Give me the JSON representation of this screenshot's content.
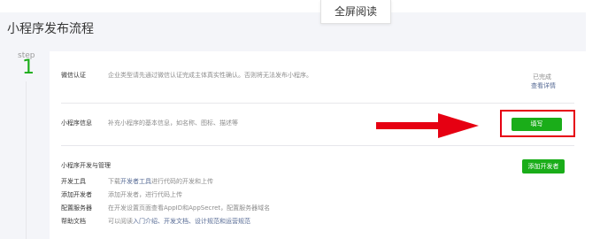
{
  "page": {
    "title": "小程序发布流程",
    "fullscreen_label": "全屏阅读"
  },
  "step": {
    "label": "step",
    "number": "1"
  },
  "rows": {
    "verify": {
      "label": "微信认证",
      "desc": "企业类型请先通过微信认证完成主体真实性确认。否则将无法发布小程序。",
      "status": "已完成",
      "link": "查看详情"
    },
    "info": {
      "label": "小程序信息",
      "desc": "补充小程序的基本信息，如名称、图标、描述等",
      "button": "填写"
    },
    "dev": {
      "header": "小程序开发与管理",
      "button": "添加开发者",
      "items": [
        {
          "label": "开发工具",
          "prefix": "下载",
          "link": "开发者工具",
          "suffix": "进行代码的开发和上传"
        },
        {
          "label": "添加开发者",
          "prefix": "添加开发者，进行代码上传",
          "link": "",
          "suffix": ""
        },
        {
          "label": "配置服务器",
          "prefix": "在开发设置页面查看AppID和AppSecret，配置服务器域名",
          "link": "",
          "suffix": ""
        },
        {
          "label": "帮助文档",
          "prefix": "可以阅读",
          "link": "入门介绍、开发文档、设计规范和运营规范",
          "suffix": ""
        }
      ]
    }
  },
  "colors": {
    "accent_green": "#1aad19",
    "highlight_red": "#e60012",
    "link_blue": "#576b95"
  },
  "icons": {
    "arrow": "arrow-right-icon"
  }
}
